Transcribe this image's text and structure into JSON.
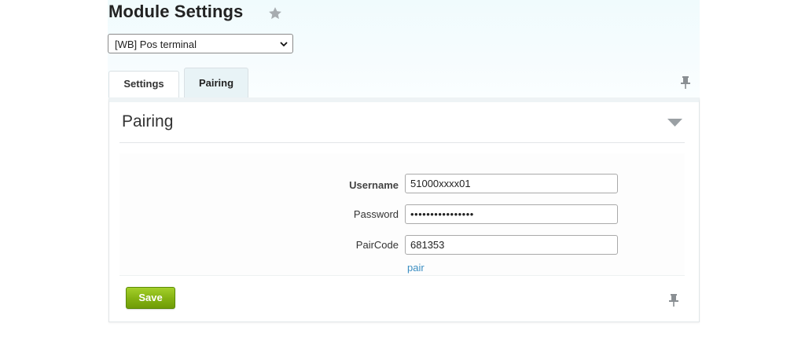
{
  "page": {
    "title": "Module Settings"
  },
  "module_select": {
    "selected": "[WB] Pos terminal"
  },
  "tabs": [
    {
      "label": "Settings"
    },
    {
      "label": "Pairing"
    }
  ],
  "section": {
    "title": "Pairing"
  },
  "form": {
    "username": {
      "label": "Username",
      "value": "51000xxxx01"
    },
    "password": {
      "label": "Password",
      "value": "••••••••••••••••"
    },
    "paircode": {
      "label": "PairCode",
      "value": "681353"
    },
    "pair_link": "pair"
  },
  "actions": {
    "save_label": "Save"
  },
  "icons": {
    "favorite": "star-icon",
    "select_arrow": "chevron-down-icon",
    "pin": "pin-icon",
    "collapse": "triangle-down-icon"
  },
  "colors": {
    "save_button": "#86b413",
    "link": "#3b8ec2",
    "header_tint": "#f0fbfd"
  }
}
